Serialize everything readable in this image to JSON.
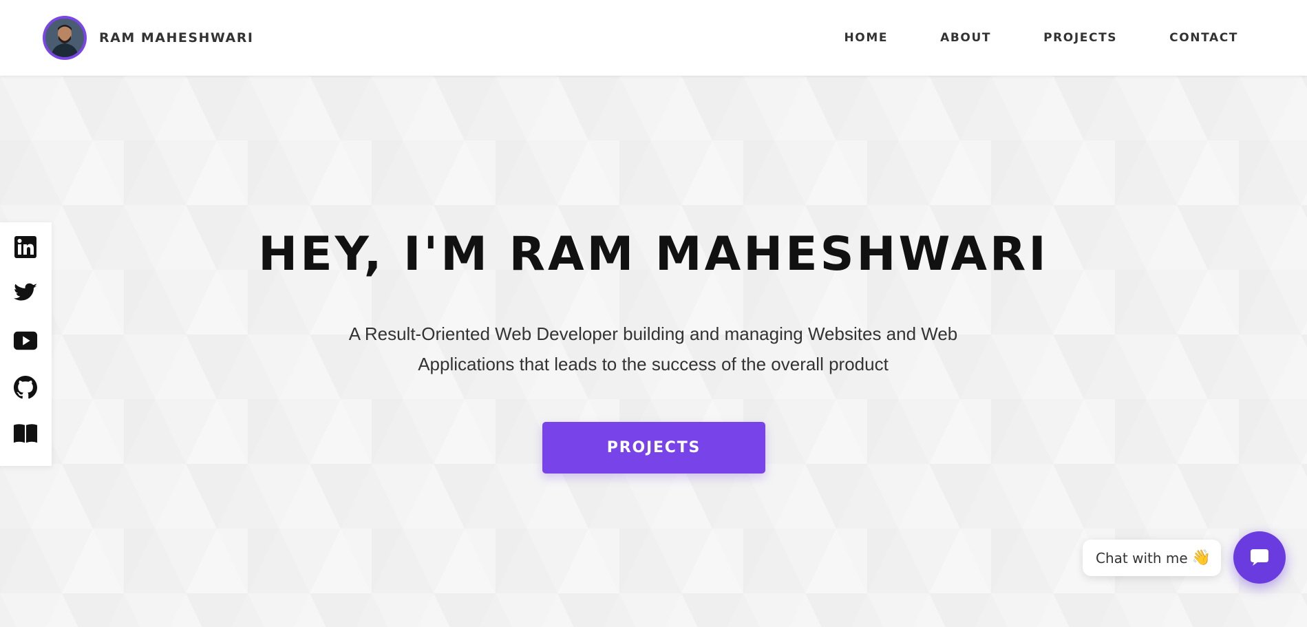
{
  "header": {
    "brand_name": "RAM MAHESHWARI",
    "nav": [
      {
        "label": "HOME"
      },
      {
        "label": "ABOUT"
      },
      {
        "label": "PROJECTS"
      },
      {
        "label": "CONTACT"
      }
    ]
  },
  "hero": {
    "title": "HEY, I'M RAM MAHESHWARI",
    "subtitle_line1": "A Result-Oriented Web Developer building and managing Websites and Web",
    "subtitle_line2": "Applications that leads to the success of the overall product",
    "cta_label": "PROJECTS"
  },
  "social": {
    "icons": [
      "linkedin-icon",
      "twitter-icon",
      "youtube-icon",
      "github-icon",
      "book-icon"
    ]
  },
  "chat": {
    "bubble_text": "Chat with me",
    "emoji": "👋"
  },
  "colors": {
    "accent": "#7843e9",
    "chat_button": "#6a3ce0",
    "heading": "#111111",
    "text": "#333333",
    "background": "#f1f1f1"
  }
}
